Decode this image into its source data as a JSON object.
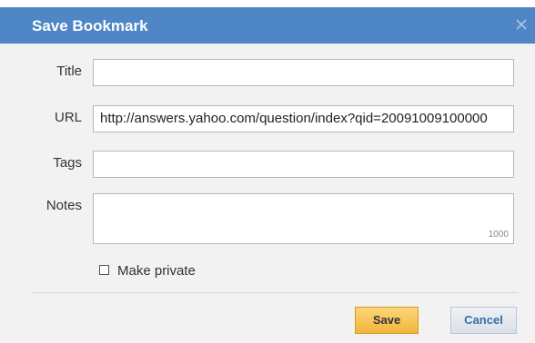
{
  "dialog": {
    "title": "Save Bookmark",
    "close_icon": "close-icon",
    "fields": {
      "title": {
        "label": "Title",
        "value": ""
      },
      "url": {
        "label": "URL",
        "value": "http://answers.yahoo.com/question/index?qid=20091009100000"
      },
      "tags": {
        "label": "Tags",
        "value": ""
      },
      "notes": {
        "label": "Notes",
        "value": "",
        "char_limit": "1000"
      }
    },
    "make_private": {
      "label": "Make private",
      "checked": false
    },
    "buttons": {
      "save": "Save",
      "cancel": "Cancel"
    }
  }
}
